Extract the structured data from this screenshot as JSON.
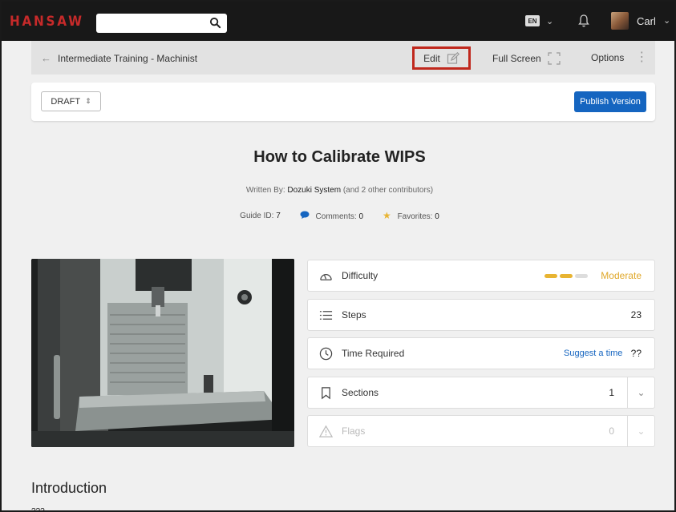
{
  "nav": {
    "logo": "HANSAW",
    "search_placeholder": "",
    "language": "EN",
    "username": "Carl"
  },
  "subbar": {
    "breadcrumb": "Intermediate Training - Machinist",
    "edit_label": "Edit",
    "fullscreen_label": "Full Screen",
    "options_label": "Options"
  },
  "toolbar": {
    "status_value": "DRAFT",
    "publish_label": "Publish Version"
  },
  "guide": {
    "title": "How to Calibrate WIPS",
    "written_by_label": "Written By:",
    "author": "Dozuki System",
    "contributors": "(and 2 other contributors)",
    "guide_id_label": "Guide ID:",
    "guide_id": "7",
    "comments_label": "Comments:",
    "comments": "0",
    "favorites_label": "Favorites:",
    "favorites": "0"
  },
  "details": {
    "difficulty_label": "Difficulty",
    "difficulty_value": "Moderate",
    "difficulty_level": 0.67,
    "steps_label": "Steps",
    "steps_value": "23",
    "time_label": "Time Required",
    "suggest_label": "Suggest a time",
    "time_value": "??",
    "sections_label": "Sections",
    "sections_value": "1",
    "flags_label": "Flags",
    "flags_value": "0"
  },
  "intro": {
    "heading": "Introduction",
    "text": "???"
  },
  "colors": {
    "nav_bg": "#181818",
    "logo": "#c62a2a",
    "accent_blue": "#1565c0",
    "highlight_red": "#c0281d",
    "difficulty": "#e8b432"
  }
}
